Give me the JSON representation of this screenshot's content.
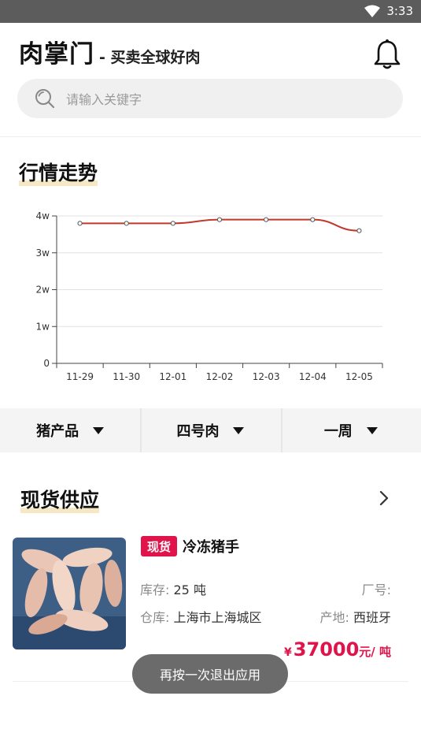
{
  "status_bar": {
    "time": "3:33",
    "wifi_icon": "wifi-icon"
  },
  "header": {
    "brand_name": "肉掌门",
    "brand_slogan": "- 买卖全球好肉",
    "bell_icon": "bell-icon"
  },
  "search": {
    "placeholder": "请输入关键字",
    "icon": "search-icon"
  },
  "trend": {
    "title": "行情走势",
    "chart_data": {
      "type": "line",
      "categories": [
        "11-29",
        "11-30",
        "12-01",
        "12-02",
        "12-03",
        "12-04",
        "12-05"
      ],
      "values": [
        38000,
        38000,
        38000,
        39000,
        39000,
        39000,
        36000
      ],
      "ylim": [
        0,
        40000
      ],
      "yticks": [
        "0",
        "1w",
        "2w",
        "3w",
        "4w"
      ],
      "line_color": "#c0392b",
      "grid": true
    }
  },
  "filters": [
    {
      "label": "猪产品"
    },
    {
      "label": "四号肉"
    },
    {
      "label": "一周"
    }
  ],
  "supply": {
    "title": "现货供应",
    "product": {
      "badge": "现货",
      "name": "冷冻猪手",
      "stock_label": "库存:",
      "stock_value": "25 吨",
      "factory_label": "厂号:",
      "warehouse_label": "仓库:",
      "warehouse_value": "上海市上海城区",
      "origin_label": "产地:",
      "origin_value": "西班牙",
      "price_currency": "¥",
      "price_value": "37000",
      "price_unit": "元/ 吨"
    }
  },
  "toast": {
    "text": "再按一次退出应用"
  },
  "colors": {
    "accent": "#e0144a",
    "line": "#c0392b",
    "highlight": "#f6e7c5"
  }
}
